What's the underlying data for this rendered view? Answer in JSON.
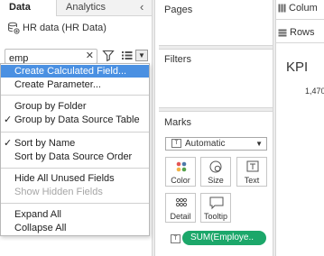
{
  "tabs": {
    "data": "Data",
    "analytics": "Analytics"
  },
  "datasource": {
    "name": "HR data (HR Data)"
  },
  "search": {
    "value": "emp"
  },
  "menu": {
    "items": [
      "Create Calculated Field...",
      "Create Parameter...",
      "Group by Folder",
      "Group by Data Source Table",
      "Sort by Name",
      "Sort by Data Source Order",
      "Hide All Unused Fields",
      "Show Hidden Fields",
      "Expand All",
      "Collapse All"
    ],
    "checked": [
      "Group by Data Source Table",
      "Sort by Name"
    ],
    "disabled": [
      "Show Hidden Fields"
    ],
    "highlighted": "Create Calculated Field..."
  },
  "shelves": {
    "pages": "Pages",
    "filters": "Filters",
    "marks": "Marks"
  },
  "marks": {
    "type": "Automatic",
    "buttons": [
      "Color",
      "Size",
      "Text",
      "Detail",
      "Tooltip"
    ],
    "pill": "SUM(Employe.."
  },
  "worksheet": {
    "columns": "Colum",
    "rows": "Rows",
    "title": "KPI",
    "value": "1,470"
  },
  "colors": {
    "highlight": "#4a90e2",
    "pill": "#1ca76a",
    "shelf_bg": "#ececec"
  }
}
